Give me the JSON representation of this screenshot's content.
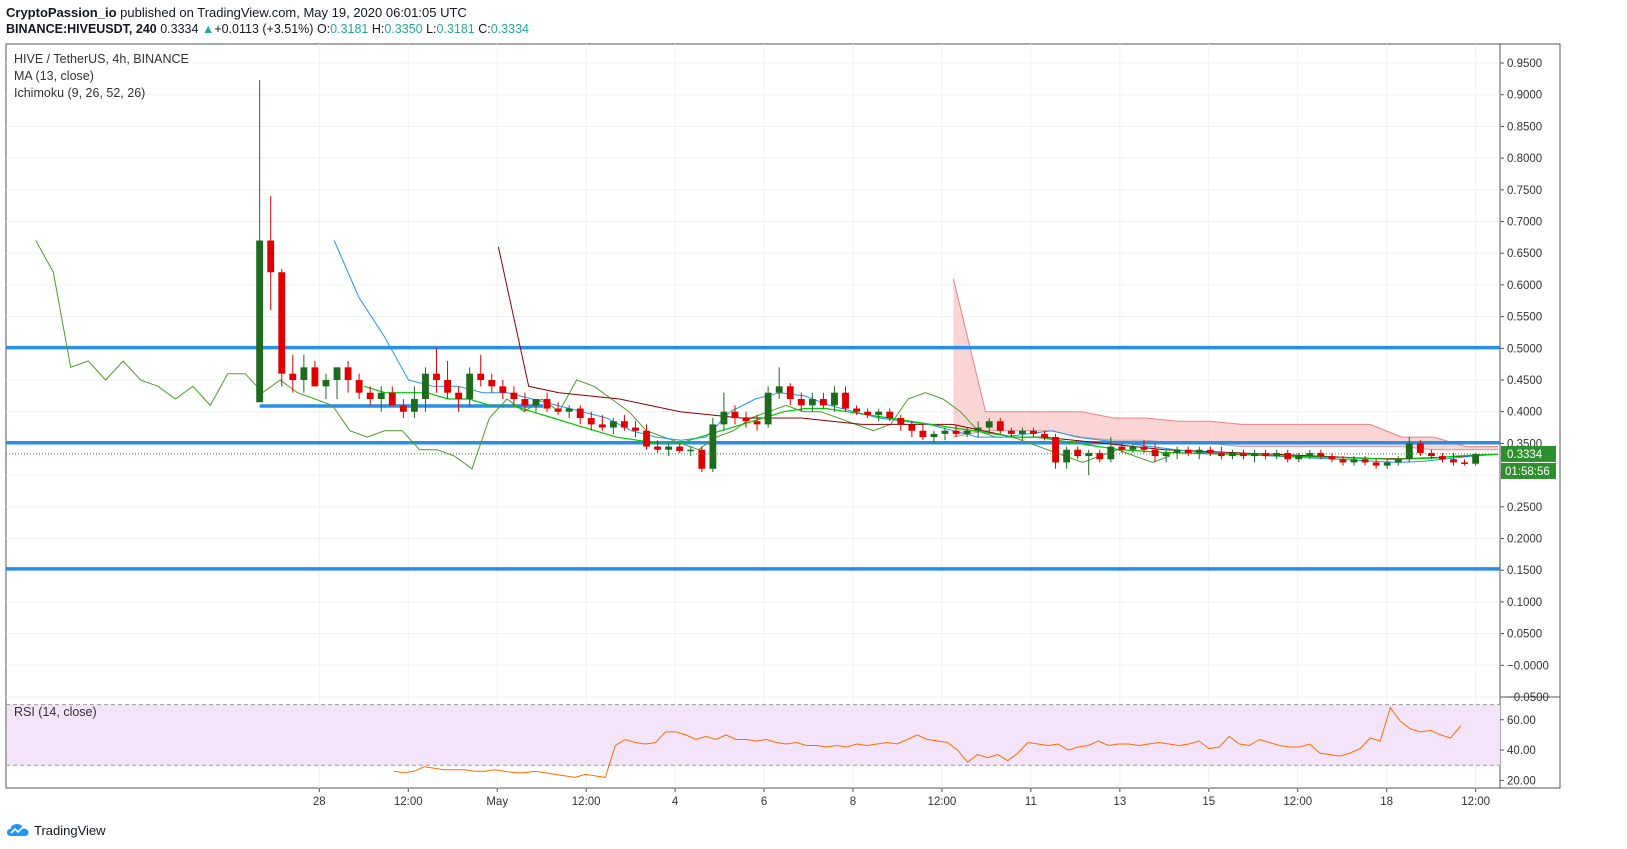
{
  "header": {
    "author": "CryptoPassion_io",
    "published_text": "published on TradingView.com, May 19, 2020 06:01:05 UTC",
    "symbol_line": "BINANCE:HIVEUSDT, 240",
    "last": "0.3334",
    "change": "+0.0113 (+3.51%)",
    "o_label": "O:",
    "o_value": "0.3181",
    "h_label": "H:",
    "h_value": "0.3350",
    "l_label": "L:",
    "l_value": "0.3181",
    "c_label": "C:",
    "c_value": "0.3334"
  },
  "legend": {
    "pair": "HIVE / TetherUS, 4h, BINANCE",
    "ma": "MA (13, close)",
    "ichimoku": "Ichimoku (9, 26, 52, 26)",
    "rsi": "RSI (14, close)"
  },
  "branding": {
    "logo_text": "TradingView"
  },
  "colors": {
    "up": "#1e6b1e",
    "down": "#e00000",
    "hline": "#2a8ee6",
    "ma": "#00c800",
    "tenkan": "#2196f3",
    "kijun": "#8b0000",
    "chikou": "#4a9e2a",
    "cloud": "#f9c7c7",
    "rsi_line": "#ff6d00",
    "rsi_band": "#f3e4f9",
    "price_tag": "#2d8f2d"
  },
  "chart_data": {
    "type": "candlestick",
    "x_tick_labels": [
      "28",
      "12:00",
      "May",
      "12:00",
      "4",
      "6",
      "8",
      "12:00",
      "11",
      "13",
      "15",
      "12:00",
      "18",
      "12:00"
    ],
    "price_axis_labels": [
      "0.9500",
      "0.9000",
      "0.8500",
      "0.8000",
      "0.7500",
      "0.7000",
      "0.6500",
      "0.6000",
      "0.5500",
      "0.5000",
      "0.4500",
      "0.4000",
      "0.3500",
      "0.3000",
      "0.2500",
      "0.2000",
      "0.1500",
      "0.1000",
      "0.0500",
      "−0.0000",
      "−0.0500"
    ],
    "y_range": [
      -0.05,
      0.98
    ],
    "current_price_label": "0.3334",
    "current_price": 0.3334,
    "countdown_label": "01:58:56",
    "horizontal_levels": [
      {
        "price": 0.501,
        "from": 0,
        "to": 1.0
      },
      {
        "price": 0.409,
        "from": 0.17,
        "to": 0.36
      },
      {
        "price": 0.351,
        "from": 0,
        "to": 1.0
      },
      {
        "price": 0.152,
        "from": 0,
        "to": 1.0
      }
    ],
    "candles": [
      [
        0.415,
        0.923,
        0.415,
        0.67
      ],
      [
        0.67,
        0.74,
        0.56,
        0.62
      ],
      [
        0.62,
        0.625,
        0.44,
        0.46
      ],
      [
        0.46,
        0.49,
        0.43,
        0.45
      ],
      [
        0.45,
        0.49,
        0.43,
        0.47
      ],
      [
        0.47,
        0.48,
        0.44,
        0.44
      ],
      [
        0.44,
        0.46,
        0.42,
        0.45
      ],
      [
        0.45,
        0.47,
        0.42,
        0.47
      ],
      [
        0.47,
        0.48,
        0.43,
        0.45
      ],
      [
        0.45,
        0.46,
        0.42,
        0.43
      ],
      [
        0.43,
        0.44,
        0.41,
        0.42
      ],
      [
        0.42,
        0.44,
        0.4,
        0.43
      ],
      [
        0.43,
        0.44,
        0.41,
        0.41
      ],
      [
        0.41,
        0.42,
        0.39,
        0.4
      ],
      [
        0.4,
        0.44,
        0.39,
        0.42
      ],
      [
        0.42,
        0.47,
        0.4,
        0.46
      ],
      [
        0.46,
        0.5,
        0.43,
        0.45
      ],
      [
        0.45,
        0.48,
        0.42,
        0.43
      ],
      [
        0.43,
        0.44,
        0.4,
        0.42
      ],
      [
        0.42,
        0.47,
        0.41,
        0.46
      ],
      [
        0.46,
        0.49,
        0.44,
        0.45
      ],
      [
        0.45,
        0.46,
        0.43,
        0.44
      ],
      [
        0.44,
        0.45,
        0.42,
        0.43
      ],
      [
        0.43,
        0.44,
        0.41,
        0.42
      ],
      [
        0.42,
        0.43,
        0.4,
        0.41
      ],
      [
        0.41,
        0.42,
        0.4,
        0.42
      ],
      [
        0.42,
        0.43,
        0.4,
        0.405
      ],
      [
        0.405,
        0.415,
        0.395,
        0.4
      ],
      [
        0.4,
        0.41,
        0.39,
        0.405
      ],
      [
        0.405,
        0.41,
        0.38,
        0.39
      ],
      [
        0.39,
        0.4,
        0.37,
        0.38
      ],
      [
        0.38,
        0.395,
        0.37,
        0.375
      ],
      [
        0.375,
        0.39,
        0.365,
        0.385
      ],
      [
        0.385,
        0.395,
        0.37,
        0.375
      ],
      [
        0.375,
        0.385,
        0.36,
        0.37
      ],
      [
        0.37,
        0.38,
        0.34,
        0.345
      ],
      [
        0.345,
        0.355,
        0.335,
        0.34
      ],
      [
        0.34,
        0.35,
        0.33,
        0.345
      ],
      [
        0.345,
        0.35,
        0.335,
        0.338
      ],
      [
        0.338,
        0.345,
        0.33,
        0.34
      ],
      [
        0.34,
        0.345,
        0.305,
        0.31
      ],
      [
        0.31,
        0.39,
        0.305,
        0.38
      ],
      [
        0.38,
        0.43,
        0.37,
        0.4
      ],
      [
        0.4,
        0.41,
        0.38,
        0.39
      ],
      [
        0.39,
        0.4,
        0.375,
        0.385
      ],
      [
        0.385,
        0.395,
        0.37,
        0.38
      ],
      [
        0.38,
        0.44,
        0.375,
        0.43
      ],
      [
        0.43,
        0.47,
        0.42,
        0.44
      ],
      [
        0.44,
        0.445,
        0.41,
        0.42
      ],
      [
        0.42,
        0.43,
        0.4,
        0.41
      ],
      [
        0.41,
        0.43,
        0.4,
        0.42
      ],
      [
        0.42,
        0.43,
        0.405,
        0.41
      ],
      [
        0.41,
        0.44,
        0.4,
        0.43
      ],
      [
        0.43,
        0.44,
        0.4,
        0.405
      ],
      [
        0.405,
        0.41,
        0.395,
        0.4
      ],
      [
        0.4,
        0.405,
        0.39,
        0.395
      ],
      [
        0.395,
        0.405,
        0.385,
        0.4
      ],
      [
        0.4,
        0.405,
        0.385,
        0.39
      ],
      [
        0.39,
        0.395,
        0.37,
        0.38
      ],
      [
        0.38,
        0.385,
        0.36,
        0.37
      ],
      [
        0.37,
        0.38,
        0.355,
        0.36
      ],
      [
        0.36,
        0.37,
        0.35,
        0.365
      ],
      [
        0.365,
        0.375,
        0.355,
        0.37
      ],
      [
        0.37,
        0.38,
        0.36,
        0.365
      ],
      [
        0.365,
        0.375,
        0.36,
        0.37
      ],
      [
        0.37,
        0.385,
        0.36,
        0.375
      ],
      [
        0.375,
        0.39,
        0.365,
        0.385
      ],
      [
        0.385,
        0.39,
        0.365,
        0.37
      ],
      [
        0.37,
        0.375,
        0.36,
        0.365
      ],
      [
        0.365,
        0.375,
        0.355,
        0.37
      ],
      [
        0.37,
        0.375,
        0.36,
        0.365
      ],
      [
        0.365,
        0.37,
        0.355,
        0.36
      ],
      [
        0.36,
        0.365,
        0.31,
        0.32
      ],
      [
        0.32,
        0.345,
        0.31,
        0.34
      ],
      [
        0.34,
        0.345,
        0.325,
        0.33
      ],
      [
        0.33,
        0.34,
        0.3,
        0.335
      ],
      [
        0.335,
        0.34,
        0.32,
        0.325
      ],
      [
        0.325,
        0.36,
        0.32,
        0.345
      ],
      [
        0.345,
        0.35,
        0.335,
        0.34
      ],
      [
        0.34,
        0.35,
        0.335,
        0.345
      ],
      [
        0.345,
        0.355,
        0.335,
        0.34
      ],
      [
        0.34,
        0.35,
        0.32,
        0.33
      ],
      [
        0.33,
        0.34,
        0.32,
        0.335
      ],
      [
        0.335,
        0.345,
        0.325,
        0.34
      ],
      [
        0.34,
        0.345,
        0.33,
        0.335
      ],
      [
        0.335,
        0.345,
        0.325,
        0.34
      ],
      [
        0.34,
        0.345,
        0.33,
        0.335
      ],
      [
        0.335,
        0.345,
        0.325,
        0.33
      ],
      [
        0.33,
        0.34,
        0.325,
        0.335
      ],
      [
        0.335,
        0.34,
        0.325,
        0.33
      ],
      [
        0.33,
        0.34,
        0.32,
        0.335
      ],
      [
        0.335,
        0.34,
        0.325,
        0.33
      ],
      [
        0.33,
        0.34,
        0.325,
        0.335
      ],
      [
        0.335,
        0.34,
        0.32,
        0.325
      ],
      [
        0.325,
        0.335,
        0.32,
        0.33
      ],
      [
        0.33,
        0.34,
        0.325,
        0.335
      ],
      [
        0.335,
        0.34,
        0.325,
        0.33
      ],
      [
        0.33,
        0.335,
        0.32,
        0.325
      ],
      [
        0.325,
        0.33,
        0.315,
        0.32
      ],
      [
        0.32,
        0.33,
        0.315,
        0.325
      ],
      [
        0.325,
        0.33,
        0.315,
        0.32
      ],
      [
        0.32,
        0.325,
        0.31,
        0.315
      ],
      [
        0.315,
        0.325,
        0.31,
        0.32
      ],
      [
        0.32,
        0.33,
        0.315,
        0.325
      ],
      [
        0.325,
        0.36,
        0.32,
        0.35
      ],
      [
        0.35,
        0.355,
        0.33,
        0.335
      ],
      [
        0.335,
        0.34,
        0.325,
        0.33
      ],
      [
        0.33,
        0.335,
        0.32,
        0.325
      ],
      [
        0.325,
        0.335,
        0.315,
        0.32
      ],
      [
        0.32,
        0.325,
        0.315,
        0.318
      ],
      [
        0.318,
        0.335,
        0.315,
        0.333
      ]
    ],
    "ma_values": [
      0.44,
      0.43,
      0.43,
      0.43,
      0.42,
      0.42,
      0.41,
      0.41,
      0.4,
      0.39,
      0.38,
      0.37,
      0.36,
      0.355,
      0.35,
      0.35,
      0.36,
      0.37,
      0.38,
      0.39,
      0.4,
      0.405,
      0.405,
      0.4,
      0.395,
      0.39,
      0.385,
      0.38,
      0.375,
      0.37,
      0.365,
      0.36,
      0.36,
      0.355,
      0.35,
      0.345,
      0.34,
      0.338,
      0.336,
      0.335,
      0.334,
      0.333,
      0.332,
      0.331,
      0.33,
      0.329,
      0.328,
      0.327,
      0.326,
      0.325,
      0.326,
      0.327,
      0.33,
      0.332,
      0.333
    ],
    "ma_span": [
      0.24,
      1.0
    ],
    "tenkan_values": [
      0.67,
      0.58,
      0.52,
      0.45,
      0.44,
      0.44,
      0.43,
      0.43,
      0.42,
      0.41,
      0.4,
      0.39,
      0.37,
      0.36,
      0.355,
      0.36,
      0.4,
      0.42,
      0.43,
      0.425,
      0.41,
      0.4,
      0.39,
      0.385,
      0.38,
      0.37,
      0.36,
      0.36,
      0.365,
      0.37,
      0.36,
      0.355,
      0.35,
      0.345,
      0.34,
      0.336,
      0.334,
      0.332,
      0.33,
      0.328,
      0.326,
      0.324,
      0.322,
      0.32,
      0.322,
      0.326,
      0.33,
      0.333
    ],
    "tenkan_span": [
      0.22,
      1.0
    ],
    "kijun_values": [
      0.66,
      0.44,
      0.43,
      0.425,
      0.42,
      0.41,
      0.4,
      0.395,
      0.39,
      0.39,
      0.39,
      0.385,
      0.38,
      0.38,
      0.38,
      0.38,
      0.37,
      0.36,
      0.36,
      0.355,
      0.35,
      0.345,
      0.34,
      0.338,
      0.336,
      0.334,
      0.332,
      0.33,
      0.328,
      0.326,
      0.326,
      0.328,
      0.33,
      0.333
    ],
    "kijun_span": [
      0.33,
      1.0
    ],
    "chikou_values": [
      0.67,
      0.62,
      0.47,
      0.48,
      0.45,
      0.48,
      0.45,
      0.44,
      0.42,
      0.44,
      0.41,
      0.46,
      0.46,
      0.43,
      0.45,
      0.43,
      0.42,
      0.41,
      0.37,
      0.36,
      0.37,
      0.37,
      0.34,
      0.34,
      0.33,
      0.31,
      0.39,
      0.42,
      0.4,
      0.42,
      0.4,
      0.45,
      0.44,
      0.42,
      0.4,
      0.37,
      0.36,
      0.35,
      0.34,
      0.36,
      0.37,
      0.39,
      0.4,
      0.41,
      0.4,
      0.4,
      0.39,
      0.38,
      0.37,
      0.38,
      0.42,
      0.43,
      0.42,
      0.4,
      0.37,
      0.36,
      0.36,
      0.35,
      0.34,
      0.33,
      0.32,
      0.33,
      0.34,
      0.33,
      0.32,
      0.33
    ],
    "chikou_span": [
      0.02,
      0.78
    ],
    "cloud_top": [
      0.61,
      0.4,
      0.4,
      0.4,
      0.4,
      0.39,
      0.39,
      0.385,
      0.385,
      0.38,
      0.38,
      0.38,
      0.38,
      0.38,
      0.36,
      0.36,
      0.345,
      0.345
    ],
    "cloud_bottom": [
      0.36,
      0.37,
      0.37,
      0.37,
      0.36,
      0.355,
      0.355,
      0.35,
      0.35,
      0.345,
      0.345,
      0.345,
      0.345,
      0.345,
      0.345,
      0.34,
      0.34,
      0.34
    ],
    "cloud_span": [
      0.635,
      1.0
    ],
    "rsi": {
      "title": "RSI (14, close)",
      "axis_labels": [
        "60.00",
        "40.00",
        "20.00"
      ],
      "y_range": [
        15,
        75
      ],
      "bands": [
        30,
        70
      ],
      "span": [
        0.26,
        0.975
      ],
      "values": [
        26,
        25,
        26,
        29,
        28,
        27,
        27,
        27,
        26,
        26,
        27,
        26,
        25,
        25,
        26,
        25,
        24,
        23,
        22,
        24,
        23,
        22,
        43,
        47,
        45,
        44,
        45,
        52,
        52,
        50,
        47,
        49,
        47,
        50,
        47,
        47,
        46,
        47,
        45,
        44,
        45,
        43,
        43,
        42,
        43,
        42,
        44,
        43,
        44,
        45,
        44,
        47,
        50,
        47,
        46,
        45,
        40,
        32,
        37,
        35,
        37,
        33,
        38,
        45,
        44,
        43,
        44,
        40,
        42,
        43,
        46,
        43,
        44,
        44,
        43,
        44,
        45,
        44,
        43,
        44,
        46,
        41,
        42,
        49,
        44,
        43,
        47,
        45,
        43,
        42,
        42,
        44,
        38,
        37,
        36,
        38,
        41,
        48,
        46,
        68,
        59,
        54,
        52,
        53,
        50,
        48,
        56
      ]
    }
  }
}
